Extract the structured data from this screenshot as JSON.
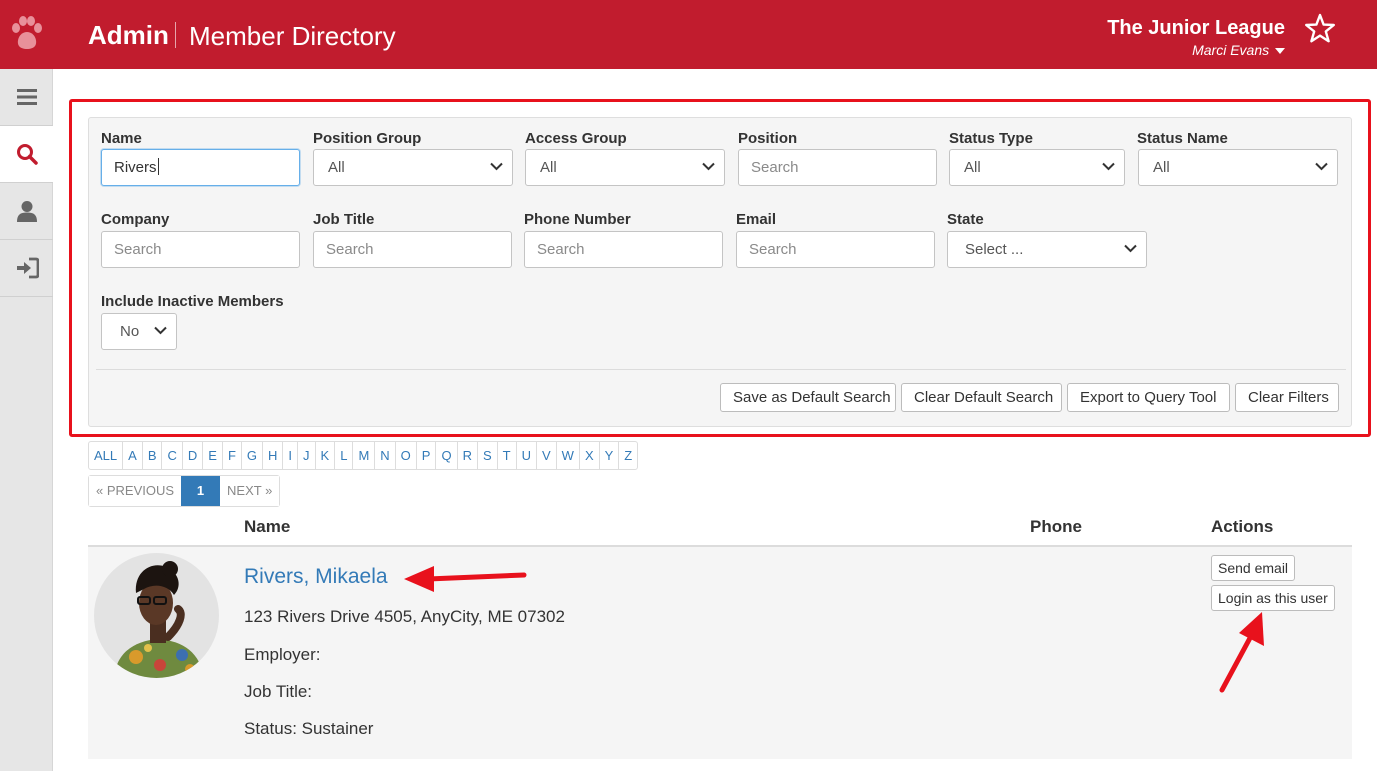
{
  "header": {
    "brand": "Admin",
    "page_title": "Member Directory",
    "org_name": "The Junior League",
    "user_name": "Marci Evans"
  },
  "sidebar": {
    "items": [
      {
        "icon": "menu-icon"
      },
      {
        "icon": "search-icon",
        "active": true
      },
      {
        "icon": "user-icon"
      },
      {
        "icon": "sign-in-icon"
      }
    ]
  },
  "filters": {
    "name": {
      "label": "Name",
      "value": "Rivers"
    },
    "position_group": {
      "label": "Position Group",
      "value": "All"
    },
    "access_group": {
      "label": "Access Group",
      "value": "All"
    },
    "position": {
      "label": "Position",
      "placeholder": "Search"
    },
    "status_type": {
      "label": "Status Type",
      "value": "All"
    },
    "status_name": {
      "label": "Status Name",
      "value": "All"
    },
    "company": {
      "label": "Company",
      "placeholder": "Search"
    },
    "job_title": {
      "label": "Job Title",
      "placeholder": "Search"
    },
    "phone": {
      "label": "Phone Number",
      "placeholder": "Search"
    },
    "email": {
      "label": "Email",
      "placeholder": "Search"
    },
    "state": {
      "label": "State",
      "value": "Select ..."
    },
    "inactive": {
      "label": "Include Inactive Members",
      "value": "No"
    }
  },
  "buttons": {
    "save_default": "Save as Default Search",
    "clear_default": "Clear Default Search",
    "export": "Export to Query Tool",
    "clear_filters": "Clear Filters"
  },
  "alphabet": [
    "ALL",
    "A",
    "B",
    "C",
    "D",
    "E",
    "F",
    "G",
    "H",
    "I",
    "J",
    "K",
    "L",
    "M",
    "N",
    "O",
    "P",
    "Q",
    "R",
    "S",
    "T",
    "U",
    "V",
    "W",
    "X",
    "Y",
    "Z"
  ],
  "pagination": {
    "prev": "« PREVIOUS",
    "current": "1",
    "next": "NEXT »"
  },
  "table": {
    "headers": {
      "name": "Name",
      "phone": "Phone",
      "actions": "Actions"
    },
    "rows": [
      {
        "name": "Rivers, Mikaela",
        "address": "123 Rivers Drive 4505, AnyCity, ME 07302",
        "employer": "Employer:",
        "job_title": "Job Title:",
        "status": "Status: Sustainer",
        "actions": {
          "send_email": "Send email",
          "login_as": "Login as this user"
        }
      }
    ]
  },
  "colors": {
    "brand": "#c11c2e",
    "link": "#337ab7",
    "highlight": "#e8111c"
  }
}
